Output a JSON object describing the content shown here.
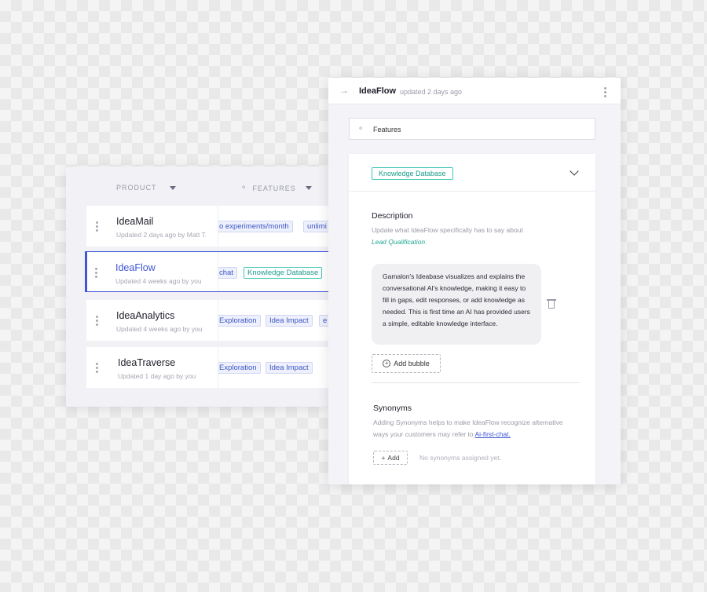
{
  "list": {
    "header": {
      "product": "PRODUCT",
      "features": "FEATURES"
    },
    "rows": [
      {
        "name": "IdeaMail",
        "meta": "Updated 2 days ago by Matt T.",
        "chips": [
          "o experiments/month",
          "unlimi"
        ]
      },
      {
        "name": "IdeaFlow",
        "meta": "Updated 4 weeks ago by you",
        "chips": [
          "chat",
          "Knowledge Database"
        ]
      },
      {
        "name": "IdeaAnalytics",
        "meta": "Updated 4 weeks ago by you",
        "chips": [
          "Exploration",
          "Idea Impact",
          "e"
        ]
      },
      {
        "name": "IdeaTraverse",
        "meta": "Updated 1 day ago by you",
        "chips": [
          "Exploration",
          "Idea Impact"
        ]
      }
    ]
  },
  "panel": {
    "title": "IdeaFlow",
    "updated": "updated 2 days ago",
    "feature_select": "Features",
    "feature_chip": "Knowledge Database",
    "description": {
      "title": "Description",
      "text_before": "Update what IdeaFlow specifically has to say about ",
      "link": "Lead Qualification",
      "text_after": "."
    },
    "bubble_text": "Gamalon's Ideabase visualizes and explains the conversational AI's knowledge, making it easy to fill in gaps, edit responses, or add knowledge as needed. This is first time an AI has provided users a simple, editable knowledge interface.",
    "add_bubble": "Add bubble",
    "synonyms": {
      "title": "Synonyms",
      "text": "Adding Synonyms helps to make IdeaFlow recognize alternative ways your customers may refer to ",
      "link": "Ai-first-chat.",
      "add": "Add",
      "empty": "No synonyms assigned yet."
    }
  },
  "colors": {
    "accent_blue": "#3f57d6",
    "teal": "#41c7b6"
  }
}
